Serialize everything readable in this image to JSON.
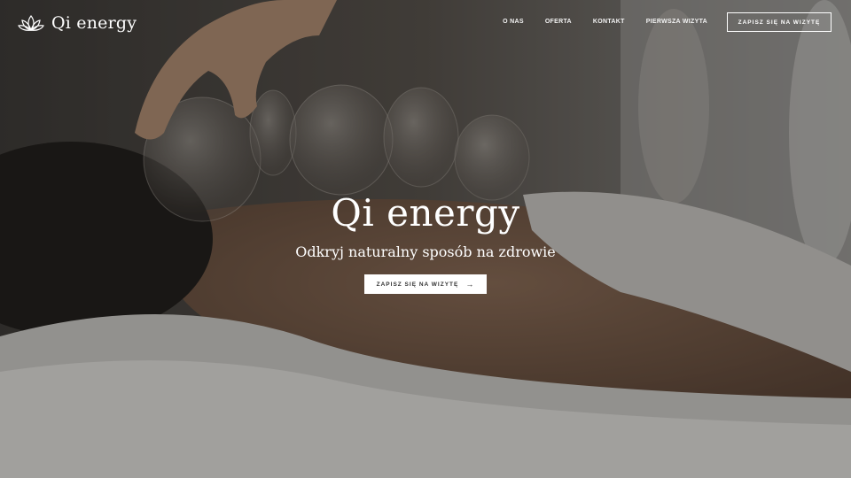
{
  "header": {
    "logo_text": "Qi energy",
    "logo_icon": "lotus-icon",
    "nav": [
      "O NAS",
      "OFERTA",
      "KONTAKT",
      "PIERWSZA WIZYTA"
    ],
    "cta_label": "ZAPISZ SIĘ NA WIZYTĘ"
  },
  "hero": {
    "title": "Qi energy",
    "subtitle": "Odkryj naturalny sposób na zdrowie",
    "cta_label": "ZAPISZ SIĘ NA WIZYTĘ",
    "cta_icon": "arrow-right-icon",
    "image": "cupping-therapy-photo"
  },
  "colors": {
    "text": "#ffffff",
    "button_bg": "#ffffff",
    "button_text": "#333333"
  }
}
